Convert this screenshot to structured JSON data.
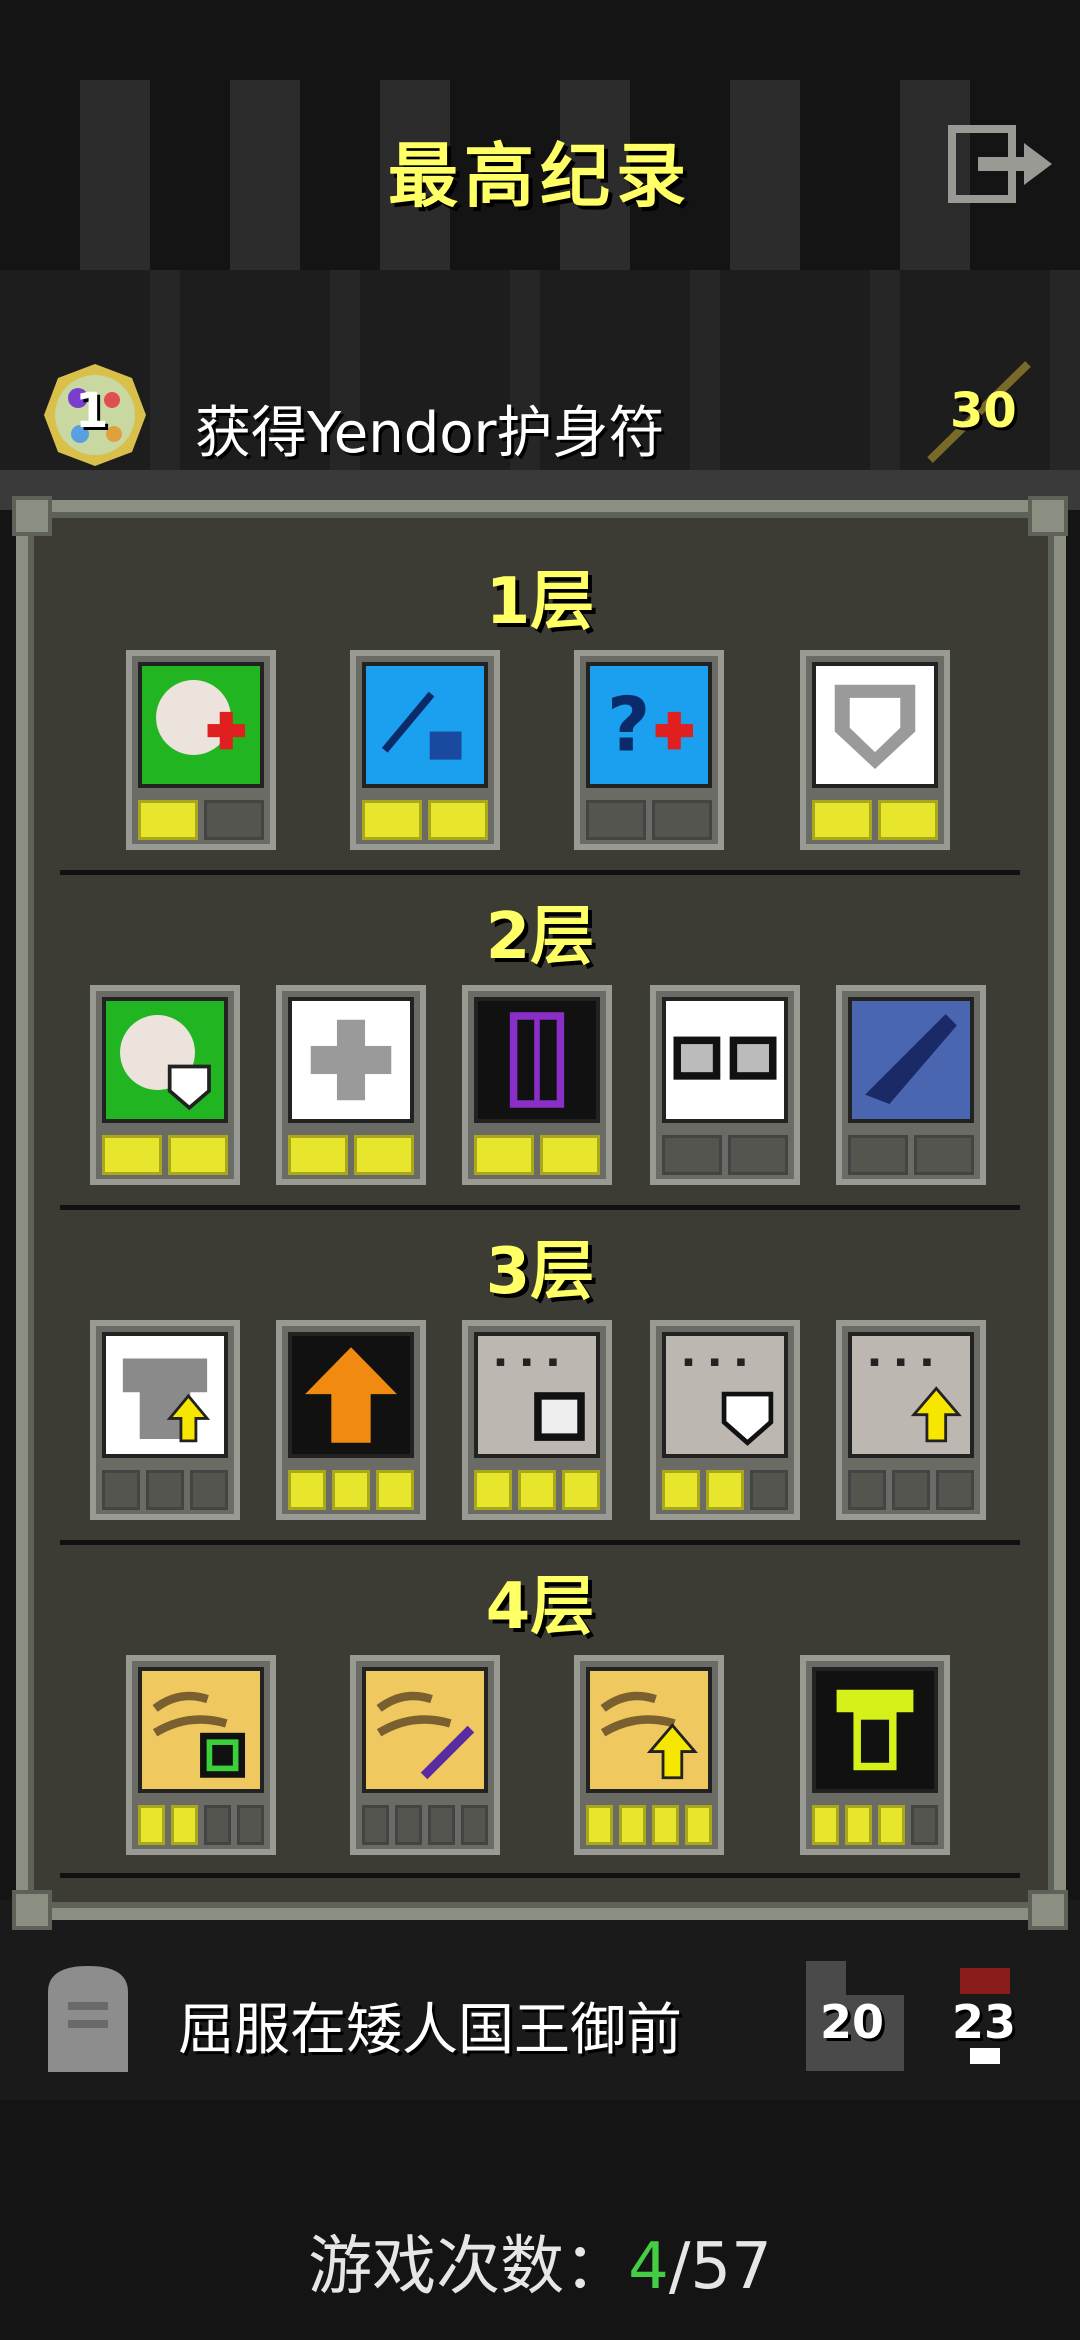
{
  "header": {
    "title": "最高纪录",
    "exit_icon": "exit-icon"
  },
  "record": {
    "rank": "1",
    "description": "获得Yendor护身符",
    "score": "30",
    "rank_icon": "amulet-icon",
    "score_icon": "wand-icon"
  },
  "tiers": [
    {
      "label": "1层",
      "badges": [
        {
          "icon": "potion-heal-icon",
          "pips": [
            1,
            0
          ]
        },
        {
          "icon": "identify-weapon-armor-icon",
          "pips": [
            1,
            1
          ]
        },
        {
          "icon": "identify-potion-icon",
          "pips": [
            0,
            0
          ]
        },
        {
          "icon": "shield-icon",
          "pips": [
            1,
            1
          ]
        }
      ]
    },
    {
      "label": "2层",
      "badges": [
        {
          "icon": "potion-shield-icon",
          "pips": [
            1,
            1
          ]
        },
        {
          "icon": "plus-icon",
          "pips": [
            1,
            1
          ]
        },
        {
          "icon": "keyhole-icon",
          "pips": [
            1,
            1
          ]
        },
        {
          "icon": "skulls-icon",
          "pips": [
            0,
            0
          ]
        },
        {
          "icon": "horn-icon",
          "pips": [
            0,
            0
          ]
        }
      ]
    },
    {
      "label": "3层",
      "badges": [
        {
          "icon": "armor-upgrade-icon",
          "pips": [
            0,
            0,
            0
          ]
        },
        {
          "icon": "arrow-up-icon",
          "pips": [
            1,
            1,
            1
          ]
        },
        {
          "icon": "boss-skull-icon",
          "pips": [
            1,
            1,
            1
          ]
        },
        {
          "icon": "boss-shield-icon",
          "pips": [
            1,
            1,
            0
          ]
        },
        {
          "icon": "boss-upgrade-icon",
          "pips": [
            0,
            0,
            0
          ]
        }
      ]
    },
    {
      "label": "4层",
      "badges": [
        {
          "icon": "scroll-map-icon",
          "pips": [
            1,
            1,
            0,
            0
          ]
        },
        {
          "icon": "scroll-sword-icon",
          "pips": [
            0,
            0,
            0,
            0
          ]
        },
        {
          "icon": "scroll-upgrade-icon",
          "pips": [
            1,
            1,
            1,
            1
          ]
        },
        {
          "icon": "green-armor-icon",
          "pips": [
            1,
            1,
            1,
            0
          ]
        }
      ]
    }
  ],
  "death": {
    "description": "屈服在矮人国王御前",
    "depth": "20",
    "level": "23",
    "tomb_icon": "tombstone-icon",
    "depth_icon": "depth-stairs-icon",
    "level_icon": "level-flag-icon"
  },
  "games": {
    "label": "游戏次数：",
    "current": "4",
    "total": "/57"
  },
  "colors": {
    "accent_yellow": "#ffff66",
    "pip_on": "#e8e62c",
    "current_green": "#44cc44"
  }
}
